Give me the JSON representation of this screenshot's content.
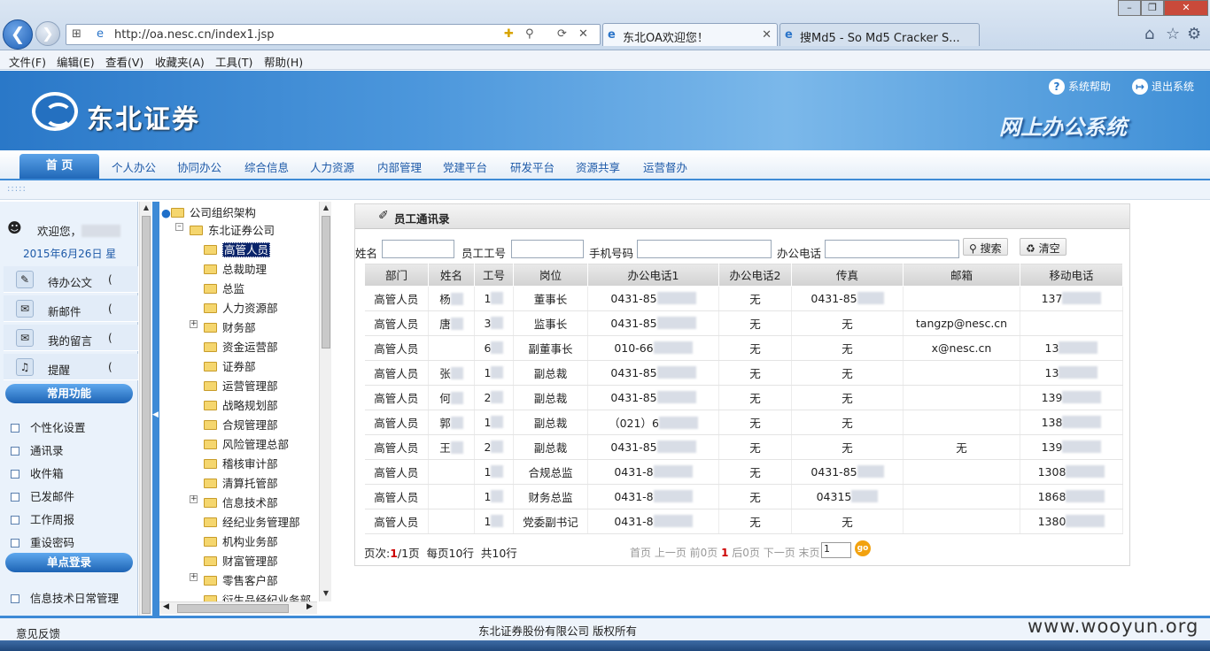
{
  "browser": {
    "url": "http://oa.nesc.cn/index1.jsp",
    "tabs": [
      {
        "label": "东北OA欢迎您！",
        "active": true
      },
      {
        "label": "搜Md5 - So Md5 Cracker S...",
        "active": false
      }
    ]
  },
  "menubar": [
    "文件(F)",
    "编辑(E)",
    "查看(V)",
    "收藏夹(A)",
    "工具(T)",
    "帮助(H)"
  ],
  "header": {
    "brand": "东北证券",
    "system_name": "网上办公系统",
    "help_link": "系统帮助",
    "logout_link": "退出系统"
  },
  "nav": {
    "home": "首 页",
    "items": [
      "个人办公",
      "协同办公",
      "综合信息",
      "人力资源",
      "内部管理",
      "党建平台",
      "研发平台",
      "资源共享",
      "运营督办"
    ]
  },
  "left": {
    "welcome": "欢迎您，",
    "date": "2015年6月26日 星",
    "quick": [
      {
        "label": "待办公文",
        "count": "("
      },
      {
        "label": "新邮件",
        "count": "("
      },
      {
        "label": "我的留言",
        "count": "("
      },
      {
        "label": "提醒",
        "count": "("
      }
    ],
    "common_title": "常用功能",
    "common": [
      "个性化设置",
      "通讯录",
      "收件箱",
      "已发邮件",
      "工作周报",
      "重设密码"
    ],
    "sso_title": "单点登录",
    "sso": [
      "信息技术日常管理"
    ]
  },
  "tree": {
    "root": "公司组织架构",
    "company": "东北证券公司",
    "nodes": [
      "高管人员",
      "总裁助理",
      "总监",
      "人力资源部",
      "财务部",
      "资金运营部",
      "证券部",
      "运营管理部",
      "战略规划部",
      "合规管理部",
      "风险管理总部",
      "稽核审计部",
      "清算托管部",
      "信息技术部",
      "经纪业务管理部",
      "机构业务部",
      "财富管理部",
      "零售客户部",
      "衍生品经纪业务部"
    ]
  },
  "main": {
    "title": "员工通讯录",
    "search": {
      "name_label": "姓名",
      "id_label": "员工工号",
      "mobile_label": "手机号码",
      "office_label": "办公电话",
      "search_btn": "搜索",
      "clear_btn": "清空"
    },
    "columns": [
      "部门",
      "姓名",
      "工号",
      "岗位",
      "办公电话1",
      "办公电话2",
      "传真",
      "邮箱",
      "移动电话"
    ],
    "rows": [
      [
        "高管人员",
        "杨",
        "1",
        "董事长",
        "0431-85",
        "无",
        "0431-85",
        "",
        "137"
      ],
      [
        "高管人员",
        "唐",
        "3",
        "监事长",
        "0431-85",
        "无",
        "无",
        "tangzp@nesc.cn",
        ""
      ],
      [
        "高管人员",
        "",
        "6",
        "副董事长",
        "010-66",
        "无",
        "无",
        "x@nesc.cn",
        "13"
      ],
      [
        "高管人员",
        "张",
        "1",
        "副总裁",
        "0431-85",
        "无",
        "无",
        "",
        "13"
      ],
      [
        "高管人员",
        "何",
        "2",
        "副总裁",
        "0431-85",
        "无",
        "无",
        "",
        "139"
      ],
      [
        "高管人员",
        "郭",
        "1",
        "副总裁",
        "（021）6",
        "无",
        "无",
        "",
        "138"
      ],
      [
        "高管人员",
        "王",
        "2",
        "副总裁",
        "0431-85",
        "无",
        "无",
        "无",
        "139"
      ],
      [
        "高管人员",
        "",
        "1",
        "合规总监",
        "0431-8",
        "无",
        "0431-85",
        "",
        "1308"
      ],
      [
        "高管人员",
        "",
        "1",
        "财务总监",
        "0431-8",
        "无",
        "04315",
        "",
        "1868"
      ],
      [
        "高管人员",
        "",
        "1",
        "党委副书记",
        "0431-8",
        "无",
        "无",
        "",
        "1380"
      ]
    ],
    "pager": {
      "page_label": "页次:",
      "page_current": "1",
      "page_total": "/1页",
      "per_page": "每页10行",
      "total": "共10行",
      "nav_text_a": "首页 上一页 前0页 ",
      "nav_current": "1",
      "nav_text_b": " 后0页 下一页 末页",
      "page_input": "1",
      "go": "go"
    }
  },
  "footer": {
    "feedback": "意见反馈",
    "copyright": "东北证券股份有限公司 版权所有"
  },
  "watermark": "www.wooyun.org"
}
